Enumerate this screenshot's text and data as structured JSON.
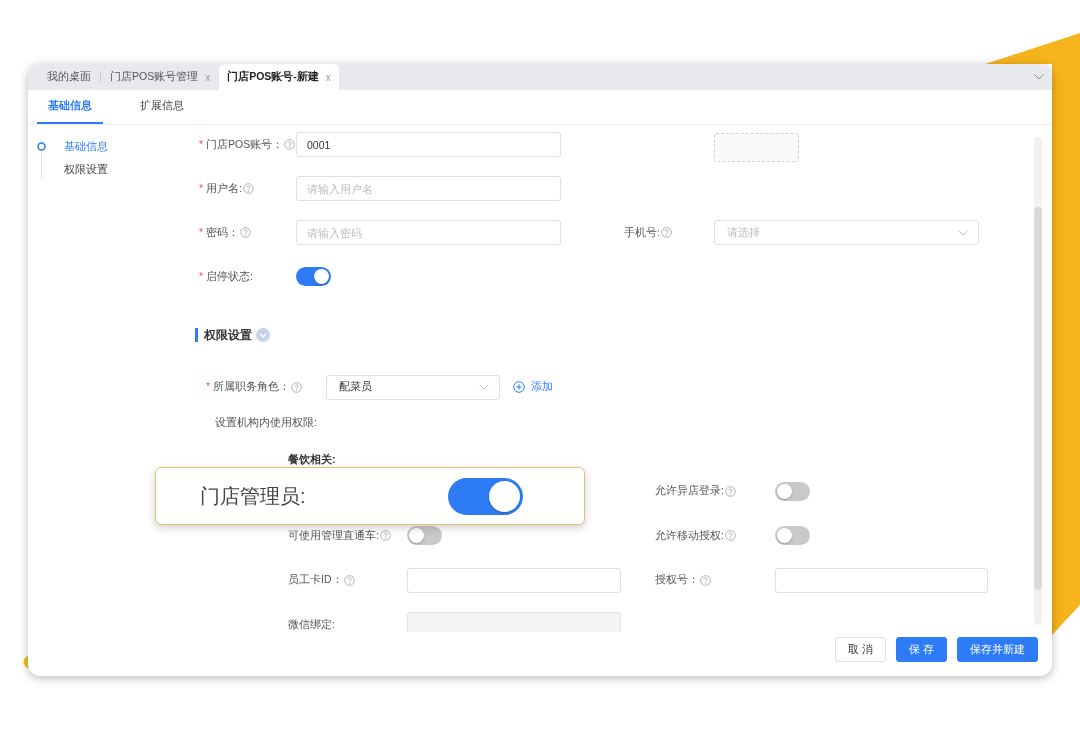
{
  "window_tabs": [
    {
      "label": "我的桌面",
      "selected": false
    },
    {
      "label": "门店POS账号管理",
      "close": "x",
      "selected": false
    },
    {
      "label": "门店POS账号-新建",
      "close": "x",
      "selected": true
    }
  ],
  "sub_tabs": [
    {
      "label": "基础信息",
      "selected": true
    },
    {
      "label": "扩展信息",
      "selected": false
    }
  ],
  "anchor_nav": [
    {
      "label": "基础信息",
      "selected": true
    },
    {
      "label": "权限设置",
      "selected": false
    }
  ],
  "basic_rows": [
    {
      "left": {
        "kind": "input",
        "required_mark": "*",
        "label": "门店POS账号：",
        "help": true,
        "value": "0001"
      },
      "right": {
        "kind": "upload"
      }
    },
    {
      "left": {
        "kind": "input",
        "required_mark": "*",
        "label": "用户名:",
        "help": true,
        "placeholder": "请输入用户名"
      }
    },
    {
      "left": {
        "kind": "input",
        "required_mark": "*",
        "label": "密码：",
        "help": true,
        "placeholder": "请输入密码"
      },
      "right": {
        "kind": "select",
        "label": "手机号:",
        "help": true,
        "placeholder": "请选择"
      }
    },
    {
      "left": {
        "kind": "switch",
        "required_mark": "*",
        "label": "启停状态:",
        "on": true
      }
    }
  ],
  "permission_section": {
    "title": "权限设置",
    "expanded": true,
    "role": {
      "kind": "select",
      "required_mark": "*",
      "label": "所属职务角色：",
      "help": true,
      "value": "配菜员"
    },
    "add_link": {
      "label": "添加"
    },
    "note": "设置机构内使用权限:",
    "group_title": "餐饮相关:",
    "rows": [
      {
        "right": {
          "kind": "switch",
          "label": "允许异店登录:",
          "help": true,
          "on": false
        }
      },
      {
        "left": {
          "kind": "switch",
          "label": "可使用管理直通车:",
          "help": true,
          "on": false
        },
        "right": {
          "kind": "switch",
          "label": "允许移动授权:",
          "help": true,
          "on": false
        }
      },
      {
        "left": {
          "kind": "input",
          "label": "员工卡ID：",
          "help": true
        },
        "right": {
          "kind": "input",
          "label": "授权号：",
          "help": true
        }
      },
      {
        "left": {
          "kind": "input",
          "label": "微信绑定:",
          "disabled": true
        }
      }
    ]
  },
  "callout": {
    "label": "门店管理员:",
    "on": true
  },
  "footer_buttons": [
    {
      "label": "取 消",
      "kind": "default"
    },
    {
      "label": "保 存",
      "kind": "primary"
    },
    {
      "label": "保存并新建",
      "kind": "primary"
    }
  ]
}
